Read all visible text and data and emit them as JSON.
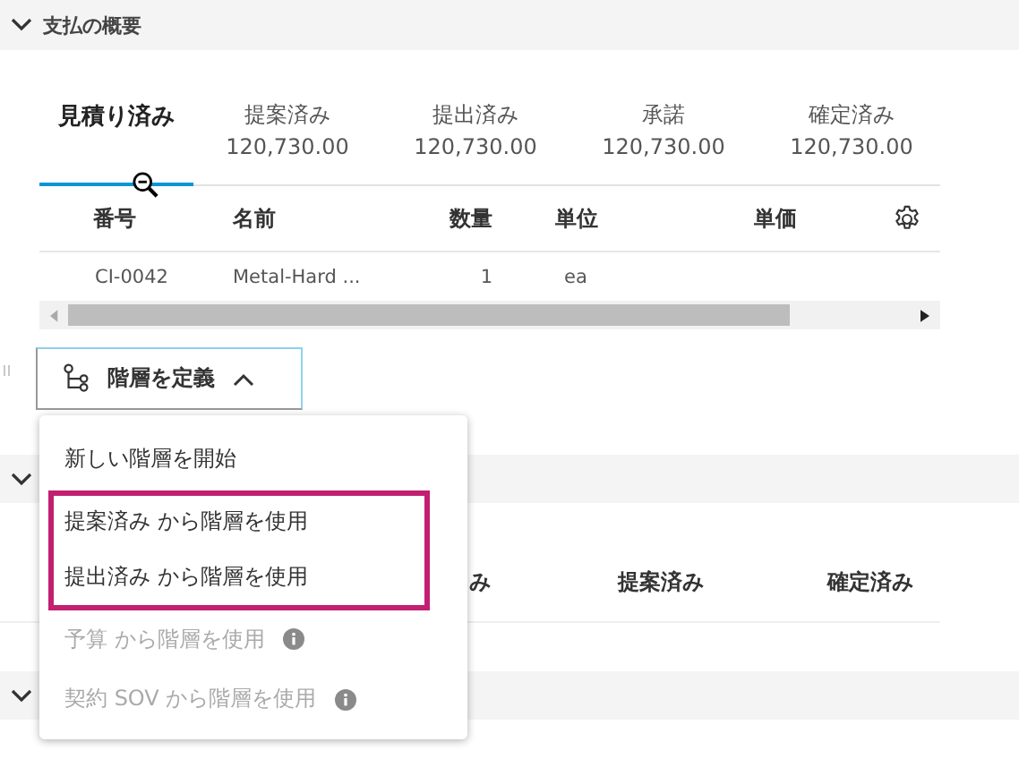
{
  "section": {
    "title": "支払の概要",
    "expanded": true
  },
  "tabs": [
    {
      "label": "見積り済み",
      "selected": true
    },
    {
      "label": "提案済み",
      "amount": "120,730.00",
      "selected": false
    },
    {
      "label": "提出済み",
      "amount": "120,730.00",
      "selected": false
    },
    {
      "label": "承諾",
      "amount": "120,730.00",
      "selected": false
    },
    {
      "label": "確定済み",
      "amount": "120,730.00",
      "selected": false
    }
  ],
  "table": {
    "columns": [
      "番号",
      "名前",
      "数量",
      "単位",
      "単価"
    ],
    "rows": [
      [
        "CI-0042",
        "Metal-Hard ...",
        "1",
        "ea"
      ]
    ]
  },
  "hierarchy_button": {
    "label": "階層を定義",
    "expanded": true
  },
  "menu": [
    {
      "label": "新しい階層を開始",
      "disabled": false,
      "highlighted": false,
      "info": false
    },
    {
      "label": "提案済み から階層を使用",
      "disabled": false,
      "highlighted": true,
      "info": false
    },
    {
      "label": "提出済み から階層を使用",
      "disabled": false,
      "highlighted": true,
      "info": false
    },
    {
      "label": "予算 から階層を使用",
      "disabled": true,
      "highlighted": false,
      "info": true
    },
    {
      "label": "契約 SOV から階層を使用",
      "disabled": true,
      "highlighted": false,
      "info": true
    }
  ],
  "section_2": {
    "columns": [
      "み",
      "提案済み",
      "確定済み"
    ]
  }
}
